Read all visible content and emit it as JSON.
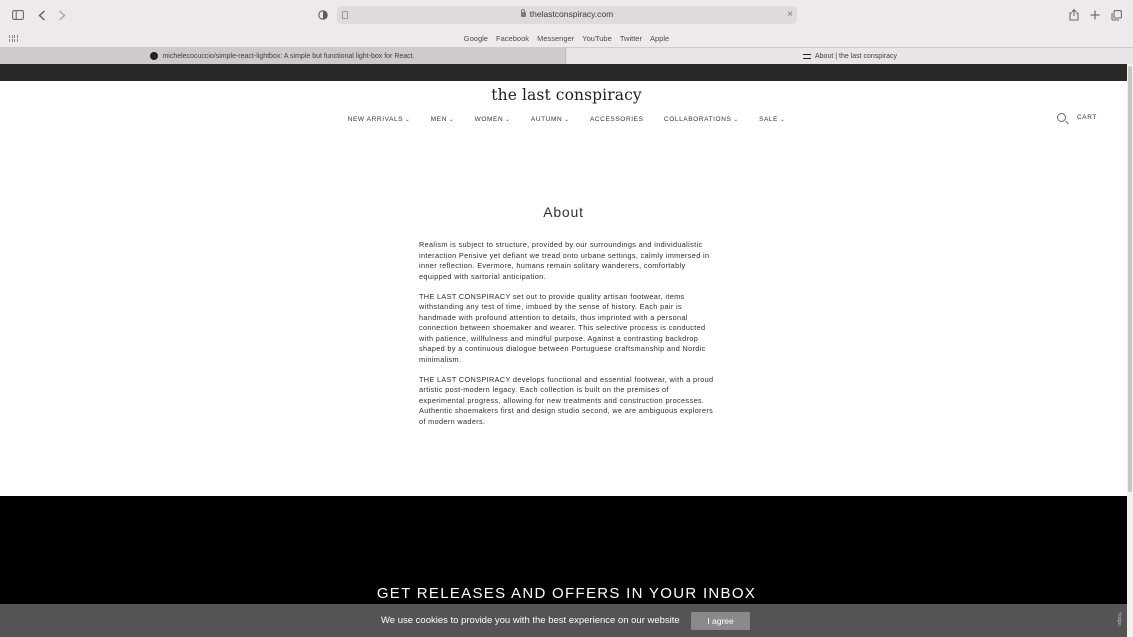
{
  "browser": {
    "url": "thelastconspiracy.com",
    "favorites": [
      "Google",
      "Facebook",
      "Messenger",
      "YouTube",
      "Twitter",
      "Apple"
    ],
    "tabs": [
      {
        "title": "michelecocuccio/simple-react-lightbox: A simple but functional light-box for React."
      },
      {
        "title": "About | the last conspiracy"
      }
    ]
  },
  "site": {
    "logo": "the last conspiracy",
    "nav": [
      {
        "label": "NEW ARRIVALS",
        "dropdown": true
      },
      {
        "label": "MEN",
        "dropdown": true
      },
      {
        "label": "WOMEN",
        "dropdown": true
      },
      {
        "label": "AUTUMN",
        "dropdown": true
      },
      {
        "label": "ACCESSORIES",
        "dropdown": false
      },
      {
        "label": "COLLABORATIONS",
        "dropdown": true
      },
      {
        "label": "SALE",
        "dropdown": true
      }
    ],
    "cart_label": "CART"
  },
  "about": {
    "title": "About",
    "paragraphs": [
      "Realism is subject to structure, provided by our surroundings and individualistic interaction Pensive yet defiant we tread onto urbane settings, calmly immersed in inner reflection. Evermore, humans remain solitary wanderers, comfortably equipped with sartorial anticipation.",
      "THE LAST CONSPIRACY set out to provide quality artisan footwear, items withstanding any test of time, imbued by the sense of history. Each pair is handmade with profound attention to details, thus imprinted with a personal connection between shoemaker and wearer. This selective process is conducted with patience, willfulness and mindful purpose. Against a contrasting backdrop shaped by a continuous dialogue between Portuguese craftsmanship and Nordic minimalism.",
      "THE LAST CONSPIRACY develops functional and essential footwear, with a proud artistic post-modern legacy. Each collection is built on the premises of experimental progress, allowing for new treatments and construction processes. Authentic shoemakers first and design studio second, we are ambiguous explorers of modern waders."
    ]
  },
  "footer": {
    "newsletter_heading": "GET RELEASES AND OFFERS IN YOUR INBOX"
  },
  "cookie": {
    "message": "We use cookies to provide you with the best experience on our website",
    "button": "I agree"
  },
  "widget": {
    "label": "Yotpo"
  },
  "colors": {
    "topbar": "#2b2928",
    "footer": "#000000",
    "cookie_bar": "#545454",
    "cookie_button": "#8a8a8a"
  },
  "icons": [
    "sidebar-icon",
    "back-icon",
    "forward-icon",
    "privacy-shield-icon",
    "lock-icon",
    "share-icon",
    "new-tab-icon",
    "tab-overview-icon",
    "favorites-grid-icon",
    "github-icon",
    "site-favicon",
    "search-icon",
    "chevron-down-icon"
  ]
}
